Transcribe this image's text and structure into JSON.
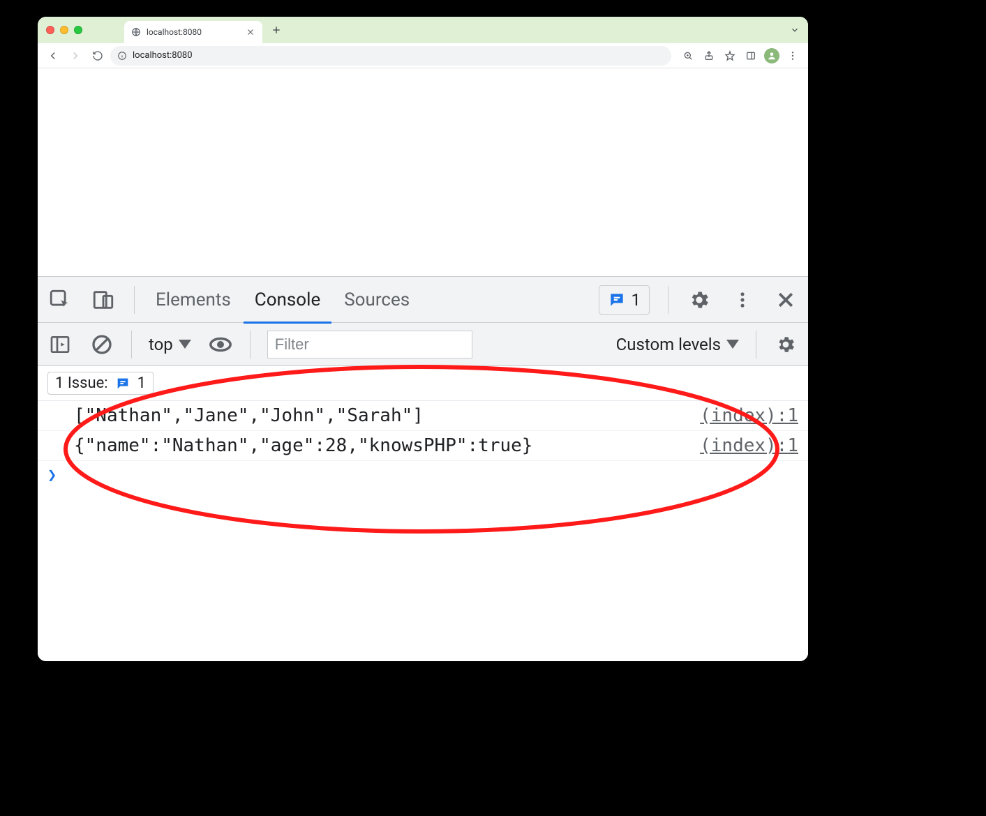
{
  "tab": {
    "title": "localhost:8080"
  },
  "url": "localhost:8080",
  "devtools": {
    "tabs": {
      "elements": "Elements",
      "console": "Console",
      "sources": "Sources"
    },
    "issue_badge_count": "1",
    "context": "top",
    "filter_placeholder": "Filter",
    "levels_label": "Custom levels",
    "issues_row_label": "1 Issue:",
    "issues_row_count": "1"
  },
  "console": {
    "lines": [
      {
        "text": "[\"Nathan\",\"Jane\",\"John\",\"Sarah\"]",
        "source": "(index):1"
      },
      {
        "text": "{\"name\":\"Nathan\",\"age\":28,\"knowsPHP\":true}",
        "source": "(index):1"
      }
    ]
  }
}
